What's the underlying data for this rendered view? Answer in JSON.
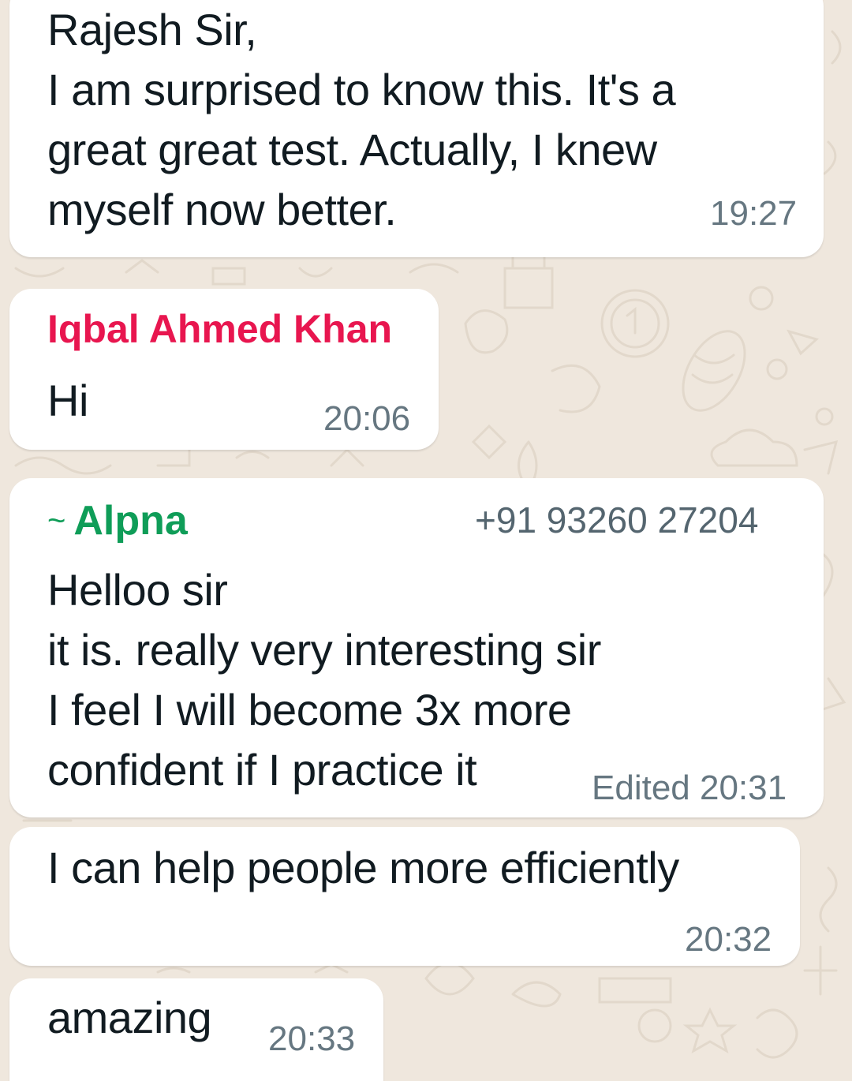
{
  "theme": {
    "chat_background": "#efe7dd",
    "bubble_background": "#ffffff",
    "timestamp_color": "#667781",
    "sender_colors": {
      "iqbal": "#e8164f",
      "alpna": "#0f9d58"
    }
  },
  "messages": [
    {
      "text": "Rajesh Sir,\nI am surprised to know this. It's a\ngreat great test. Actually, I knew\nmyself now better.",
      "time": "19:27"
    },
    {
      "sender": "Iqbal Ahmed Khan",
      "text": "Hi",
      "time": "20:06"
    },
    {
      "sender_prefix": "~",
      "sender": "Alpna",
      "phone": "+91 93260 27204",
      "text": "Helloo sir\nit is. really very interesting sir\nI feel I will become  3x more\nconfident if I practice it",
      "time": "Edited 20:31"
    },
    {
      "text": "I can help people more efficiently",
      "time": "20:32"
    },
    {
      "text": "amazing",
      "time": "20:33"
    }
  ]
}
